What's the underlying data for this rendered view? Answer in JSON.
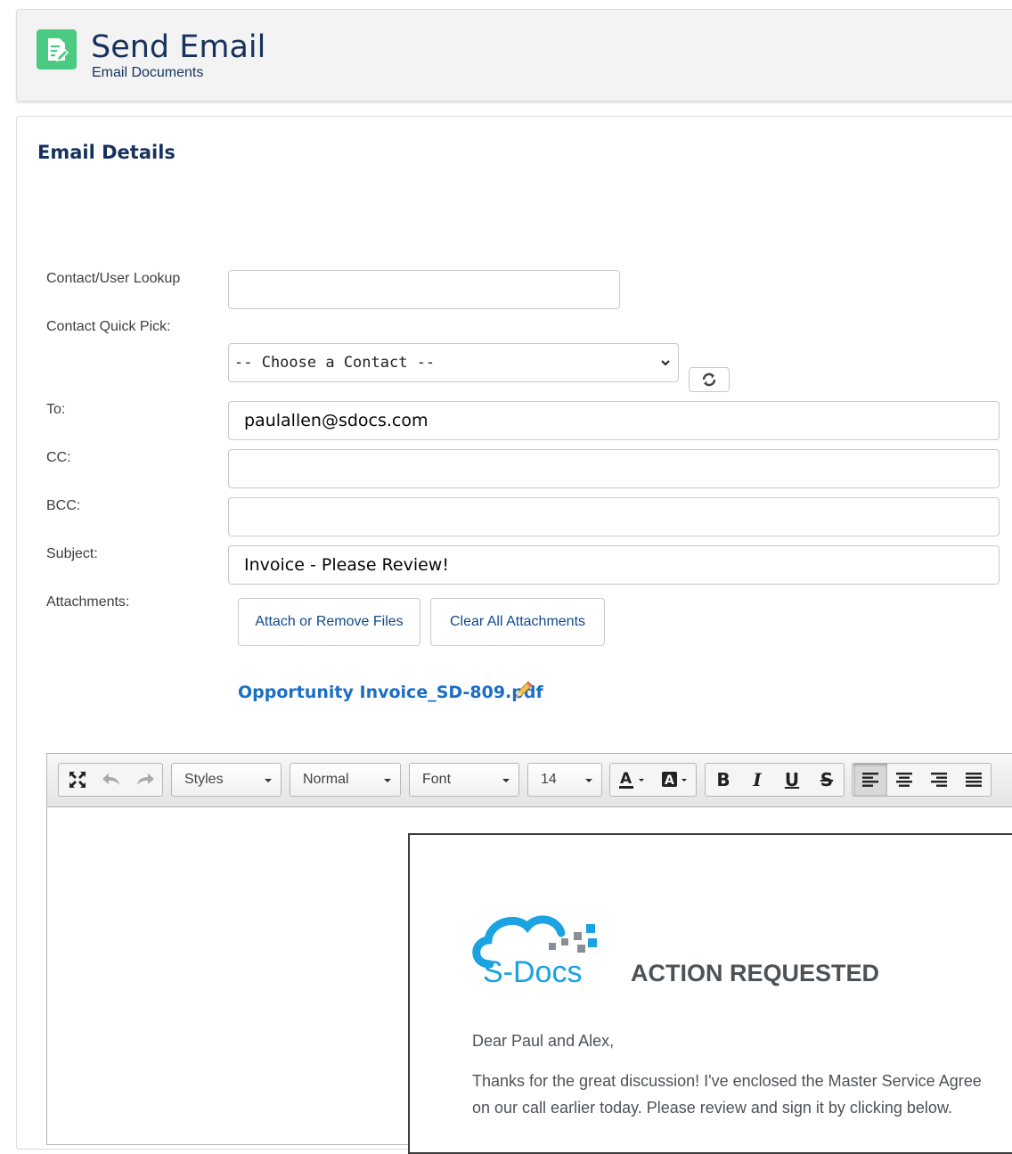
{
  "header": {
    "title": "Send Email",
    "subtitle": "Email Documents",
    "icon": "document-edit-icon",
    "icon_color": "#4bca81"
  },
  "card": {
    "title": "Email Details"
  },
  "form": {
    "lookup_label": "Contact/User Lookup",
    "lookup_value": "",
    "quick_pick_label": "Contact Quick Pick:",
    "quick_pick_selected": "-- Choose a Contact --",
    "to_label": "To:",
    "to_value": "paulallen@sdocs.com",
    "cc_label": "CC:",
    "cc_value": "",
    "bcc_label": "BCC:",
    "bcc_value": "",
    "subject_label": "Subject:",
    "subject_value": "Invoice - Please Review!",
    "attachments_label": "Attachments:",
    "attach_button": "Attach or Remove Files",
    "clear_button": "Clear All Attachments",
    "attachment_file": "Opportunity Invoice_SD-809.pdf"
  },
  "toolbar": {
    "styles": "Styles",
    "format": "Normal",
    "font": "Font",
    "size": "14",
    "bold": "B",
    "italic": "I",
    "underline": "U",
    "strike": "S"
  },
  "email_body": {
    "logo_text": "S-Docs",
    "heading": "ACTION REQUESTED",
    "greeting": "Dear Paul and Alex,",
    "line1": "Thanks for the great discussion! I've enclosed the Master Service Agree",
    "line2": "on our call earlier today. Please review and sign it by clicking below."
  },
  "colors": {
    "brand_navy": "#16325c",
    "link_blue": "#1a6fc4",
    "button_text": "#0f4a8c",
    "logo_blue": "#1aa3e0"
  }
}
